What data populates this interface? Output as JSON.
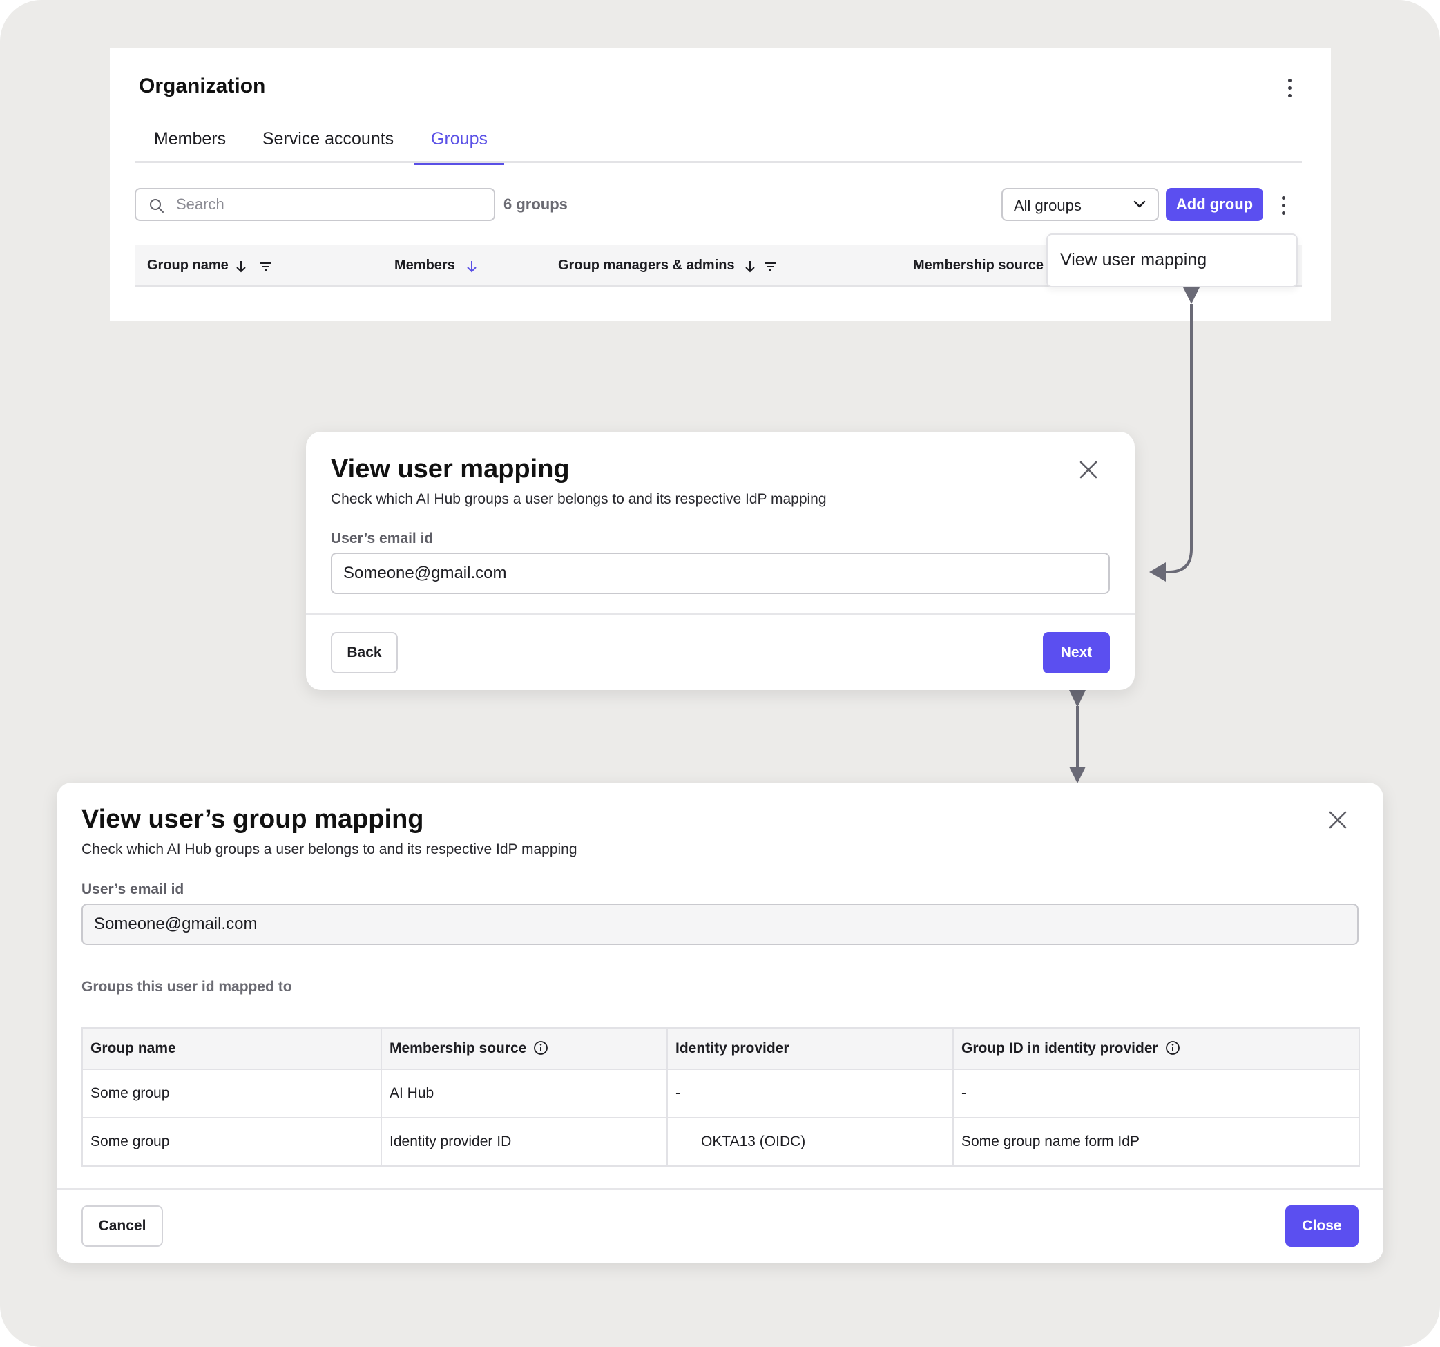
{
  "colors": {
    "accent": "#5b4ff0",
    "tab_active": "#5a50e6",
    "background": "#ecebe9",
    "connector": "#6a6a76"
  },
  "org": {
    "title": "Organization",
    "tabs": [
      {
        "label": "Members",
        "active": false
      },
      {
        "label": "Service accounts",
        "active": false
      },
      {
        "label": "Groups",
        "active": true
      }
    ],
    "search": {
      "placeholder": "Search"
    },
    "group_count": "6 groups",
    "filter_select": {
      "value": "All groups"
    },
    "add_group_label": "Add group",
    "table_headers": [
      {
        "label": "Group name",
        "icons": [
          "arrow-down-icon",
          "filter-icon"
        ]
      },
      {
        "label": "Members",
        "icons": [
          "arrow-down-icon"
        ]
      },
      {
        "label": "Group managers & admins",
        "icons": [
          "arrow-down-icon",
          "filter-icon"
        ]
      },
      {
        "label": "Membership source",
        "icons": []
      }
    ],
    "menu": {
      "items": [
        {
          "label": "View user mapping"
        }
      ]
    }
  },
  "dialog_mapping": {
    "title": "View user mapping",
    "subtitle": "Check which AI Hub groups a user belongs to and its respective IdP mapping",
    "email_label": "User’s email id",
    "email_value": "Someone@gmail.com",
    "back_label": "Back",
    "next_label": "Next"
  },
  "dialog_group_mapping": {
    "title": "View user’s group mapping",
    "subtitle": "Check which AI Hub groups a user belongs to and its respective IdP mapping",
    "email_label": "User’s email id",
    "email_value": "Someone@gmail.com",
    "section_label": "Groups this user id mapped to",
    "table": {
      "columns": [
        {
          "label": "Group name",
          "info": false
        },
        {
          "label": "Membership source",
          "info": true
        },
        {
          "label": "Identity provider",
          "info": false
        },
        {
          "label": "Group ID in identity provider",
          "info": true
        }
      ],
      "rows": [
        [
          "Some group",
          "AI Hub",
          "-",
          "-"
        ],
        [
          "Some group",
          "Identity provider ID",
          "OKTA13 (OIDC)",
          "Some group name form IdP"
        ]
      ]
    },
    "cancel_label": "Cancel",
    "close_label": "Close"
  }
}
